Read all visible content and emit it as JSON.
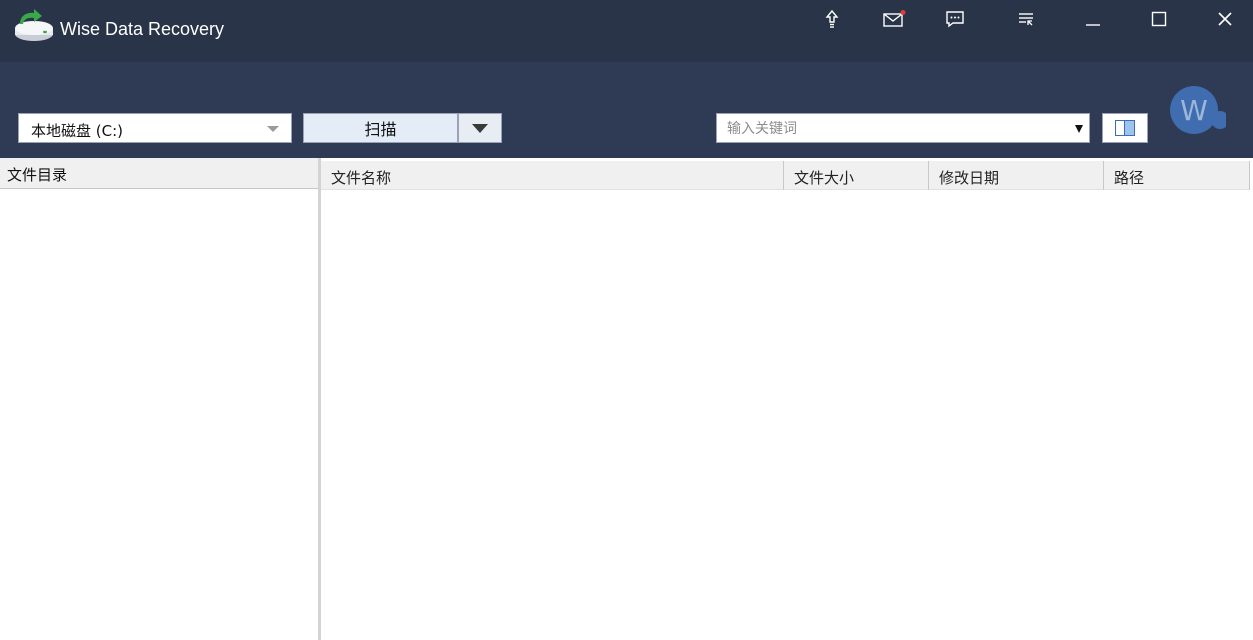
{
  "app": {
    "title": "Wise Data Recovery"
  },
  "titlebar_icons": [
    "upgrade-icon",
    "mail-icon",
    "feedback-icon",
    "menu-icon"
  ],
  "window_controls": [
    "minimize-icon",
    "maximize-icon",
    "close-icon"
  ],
  "toolbar": {
    "drive_select": "本地磁盘 (C:)",
    "scan_label": "扫描",
    "search_placeholder": "输入关键词"
  },
  "avatar": {
    "letter": "W"
  },
  "left_pane": {
    "header": "文件目录"
  },
  "table": {
    "columns": [
      "文件名称",
      "文件大小",
      "修改日期",
      "路径"
    ],
    "rows": []
  },
  "colors": {
    "titlebar": "#293449",
    "toolbar": "#2f3b54",
    "scan_button": "#e3ecf7",
    "notification_dot": "#e53935",
    "logo_green": "#3aa84a"
  }
}
